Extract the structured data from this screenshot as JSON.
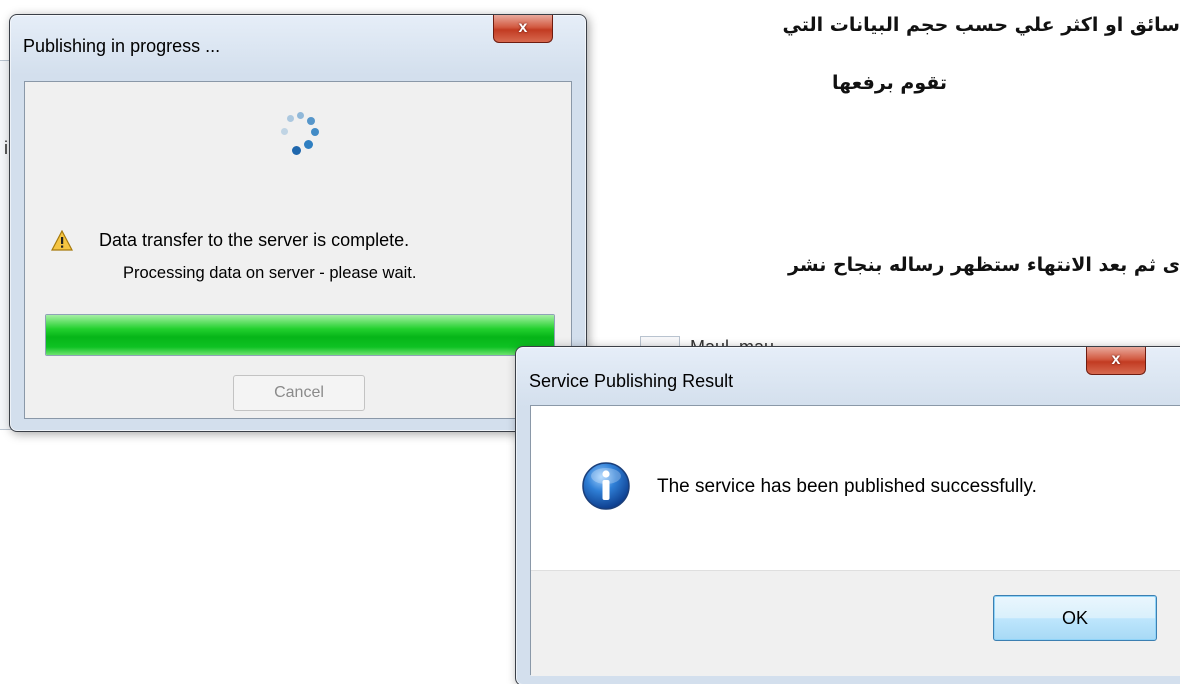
{
  "document": {
    "arabic_line1": "سائق او اكثر علي حسب حجم البيانات التي",
    "arabic_line2": "تقوم برفعها",
    "arabic_line3": "ى ثم بعد الانتهاء ستظهر رساله بنجاح نشر"
  },
  "background_app": {
    "label_fragment": "Maul_mau",
    "side_char": "i"
  },
  "publishing_dialog": {
    "title": "Publishing in progress ...",
    "close_label": "x",
    "icon": "warning-icon",
    "message": "Data transfer to the server is complete.",
    "sub_message": "Processing data on server - please wait.",
    "progress": 1.0,
    "progress_color": "#0ec223",
    "cancel_label": "Cancel"
  },
  "result_dialog": {
    "title": "Service Publishing Result",
    "close_label": "x",
    "icon": "info-icon",
    "message": "The service has been published successfully.",
    "ok_label": "OK"
  }
}
